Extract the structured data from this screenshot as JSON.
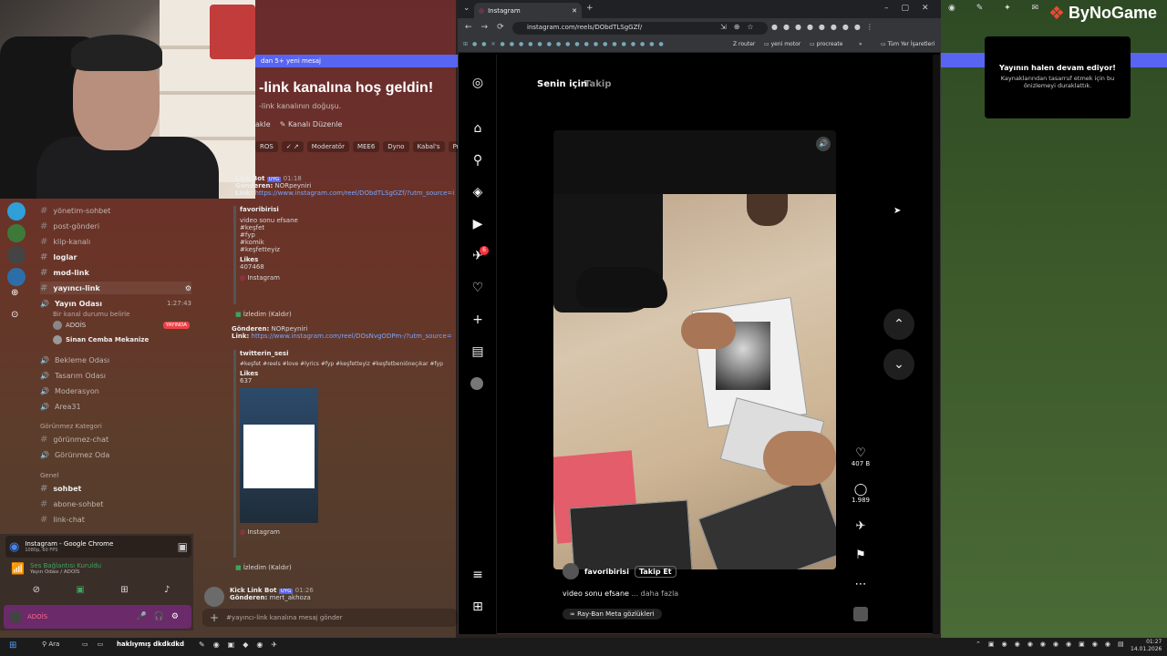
{
  "streamer": {
    "logo": "ByNoGame"
  },
  "discord": {
    "new_messages_banner": "dan 5+ yeni mesaj",
    "welcome_title": "-link kanalına hoş geldin!",
    "welcome_sub": "-link kanalının doğuşu.",
    "header_actions": [
      "akle",
      "Kanalı Düzenle"
    ],
    "role_chips": [
      "ROS",
      "Moderatör",
      "MEE6",
      "Dyno",
      "Kabal's",
      "ProBot"
    ],
    "channels": [
      {
        "name": "yönetim-sohbet",
        "bold": false
      },
      {
        "name": "post-gönderi",
        "bold": false
      },
      {
        "name": "klip-kanalı",
        "bold": false
      },
      {
        "name": "loglar",
        "bold": true
      },
      {
        "name": "mod-link",
        "bold": true
      },
      {
        "name": "yayıncı-link",
        "bold": true
      }
    ],
    "voice": {
      "name": "Yayın Odası",
      "time": "1:27:43",
      "desc": "Bir kanal durumu belirle",
      "members": [
        {
          "name": "ADOİS",
          "badge": "YAYINDA"
        },
        {
          "name": "Sinan Cemba Mekanize",
          "badge": ""
        }
      ]
    },
    "voice_channels": [
      "Bekleme Odası",
      "Tasarım Odası",
      "Moderasyon",
      "Area31"
    ],
    "category_hidden": "Görünmez Kategori",
    "hidden_channels": [
      "görünmez-chat",
      "Görünmez Oda"
    ],
    "category_general": "Genel",
    "general_channels": [
      "sohbet",
      "abone-sohbet",
      "link-chat"
    ],
    "messages": [
      {
        "author": "Link Bot",
        "tag": "UYG",
        "time": "01:18",
        "from_label": "Gönderen:",
        "from": "NORpeyniri",
        "link_label": "Link:",
        "link": "https://www.instagram.com/reel/DObdTLSgGZf/?utm_source=i",
        "embed_author": "favoribirisi",
        "embed_text": [
          "video sonu efsane",
          "#keşfet",
          "#fyp",
          "#komik",
          "#keşfetteyiz"
        ],
        "likes_label": "Likes",
        "likes": "407468",
        "footer": "Instagram",
        "action": "İzledim (Kaldır)"
      },
      {
        "from_label": "Gönderen:",
        "from": "NORpeyniri",
        "link_label": "Link:",
        "link": "https://www.instagram.com/reel/DOsNvgODPm-/?utm_source=",
        "embed_author": "twitterin_sesi",
        "embed_text": [
          "#keşfet #reels #love #lyrics #fyp #keşfetteyiz #keşfetbeniöneçıkar #fyp"
        ],
        "likes_label": "Likes",
        "likes": "637",
        "footer": "Instagram",
        "action": "İzledim (Kaldır)"
      },
      {
        "author": "Kick Link Bot",
        "tag": "UYG",
        "time": "01:26",
        "from_label": "Gönderen:",
        "from": "mert_akhoza"
      }
    ],
    "input_placeholder": "#yayıncı-link kanalına mesaj gönder",
    "stream_panel": {
      "title": "Instagram - Google Chrome",
      "sub": "1080p, 60 FPS"
    },
    "voice_status": {
      "title": "Ses Bağlantısı Kuruldu",
      "sub": "Yayın Odası / ADOİS"
    },
    "user": {
      "name": "ADOİS"
    }
  },
  "chrome": {
    "tab_title": "Instagram",
    "url": "instagram.com/reels/DObdTLSgGZf/",
    "bookmarks": [
      "router",
      "yeni motor",
      "procreate",
      "Tüm Yer İşaretleri"
    ]
  },
  "instagram": {
    "tabs": [
      "Senin için",
      "Takip"
    ],
    "notification_count": "6",
    "reel": {
      "author": "favoribirisi",
      "follow": "Takip Et",
      "caption": "video sonu efsane",
      "more": "... daha fazla",
      "music_tag": "Ray-Ban Meta gözlükleri",
      "likes": "407 B",
      "comments": "1.989"
    }
  },
  "obs_notice": {
    "title": "Yayının halen devam ediyor!",
    "body": "Kaynaklarından tasarruf etmek için bu önizlemeyi duraklattık."
  },
  "taskbar": {
    "search": "Ara",
    "overlay_text": "haklıymış dkdkdkd",
    "time": "01:27",
    "date": "14.01.2026"
  }
}
